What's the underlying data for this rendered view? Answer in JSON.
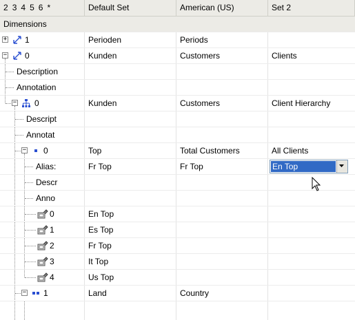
{
  "header": {
    "levels": [
      "2",
      "3",
      "4",
      "5",
      "6",
      "*"
    ],
    "columns": [
      "Default Set",
      "American (US)",
      "Set 2"
    ]
  },
  "section": "Dimensions",
  "rows": [
    {
      "label": "1",
      "default": "Perioden",
      "american": "Periods",
      "set2": ""
    },
    {
      "label": "0",
      "default": "Kunden",
      "american": "Customers",
      "set2": "Clients"
    },
    {
      "label": "Description",
      "default": "",
      "american": "",
      "set2": ""
    },
    {
      "label": "Annotation",
      "default": "",
      "american": "",
      "set2": ""
    },
    {
      "label": "0",
      "default": "Kunden",
      "american": "Customers",
      "set2": "Client Hierarchy"
    },
    {
      "label": "Descript",
      "default": "",
      "american": "",
      "set2": ""
    },
    {
      "label": "Annotat",
      "default": "",
      "american": "",
      "set2": ""
    },
    {
      "label": "0",
      "default": "Top",
      "american": "Total Customers",
      "set2": "All Clients"
    },
    {
      "label": "Alias:",
      "default": "Fr Top",
      "american": "Fr Top",
      "set2": "En Top"
    },
    {
      "label": "Descr",
      "default": "",
      "american": "",
      "set2": ""
    },
    {
      "label": "Anno",
      "default": "",
      "american": "",
      "set2": ""
    },
    {
      "label": "0",
      "default": "En Top",
      "american": "",
      "set2": ""
    },
    {
      "label": "1",
      "default": "Es Top",
      "american": "",
      "set2": ""
    },
    {
      "label": "2",
      "default": "Fr Top",
      "american": "",
      "set2": ""
    },
    {
      "label": "3",
      "default": "It Top",
      "american": "",
      "set2": ""
    },
    {
      "label": "4",
      "default": "Us Top",
      "american": "",
      "set2": ""
    },
    {
      "label": "1",
      "default": "Land",
      "american": "Country",
      "set2": ""
    }
  ],
  "colors": {
    "selection": "#316ac5",
    "header": "#ecebe6",
    "link_icon": "#2a4fd1"
  }
}
